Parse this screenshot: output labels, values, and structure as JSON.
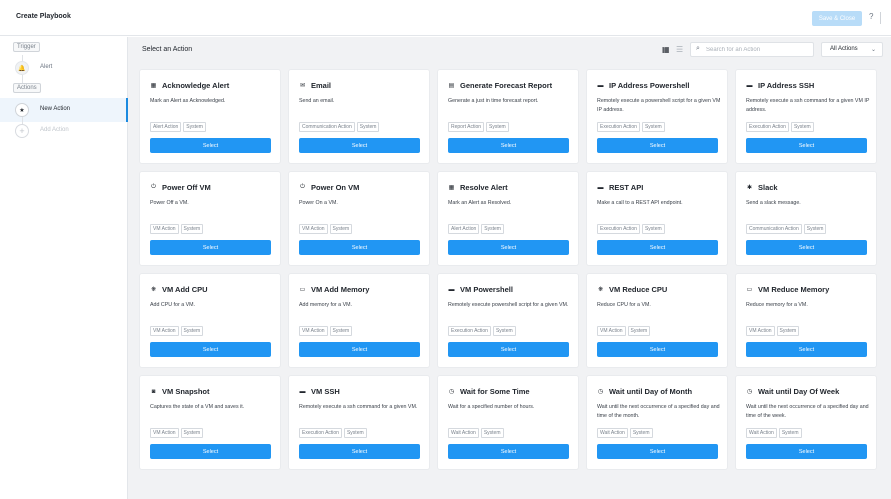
{
  "header": {
    "title": "Create Playbook",
    "save_label": "Save & Close",
    "help_label": "?"
  },
  "sidebar": {
    "trigger_tag": "Trigger",
    "trigger_item": "Alert",
    "actions_tag": "Actions",
    "selected_item": "New Action",
    "add_item": "Add Action"
  },
  "main": {
    "title": "Select an Action",
    "search_placeholder": "Search for an Action",
    "filter_label": "All Actions",
    "select_label": "Select"
  },
  "cards": [
    {
      "title": "Acknowledge Alert",
      "icon": "calendar-check-icon",
      "glyph": "▦",
      "desc": "Mark an Alert as Acknowledged.",
      "tags": [
        "Alert Action",
        "System"
      ]
    },
    {
      "title": "Email",
      "icon": "envelope-icon",
      "glyph": "✉",
      "desc": "Send an email.",
      "tags": [
        "Communication Action",
        "System"
      ]
    },
    {
      "title": "Generate Forecast Report",
      "icon": "report-icon",
      "glyph": "▤",
      "desc": "Generate a just in time forecast report.",
      "tags": [
        "Report Action",
        "System"
      ]
    },
    {
      "title": "IP Address Powershell",
      "icon": "terminal-icon",
      "glyph": "▬",
      "desc": "Remotely execute a powershell script for a given VM IP address.",
      "tags": [
        "Execution Action",
        "System"
      ]
    },
    {
      "title": "IP Address SSH",
      "icon": "terminal-icon",
      "glyph": "▬",
      "desc": "Remotely execute a ssh command for a given VM IP address.",
      "tags": [
        "Execution Action",
        "System"
      ]
    },
    {
      "title": "Power Off VM",
      "icon": "power-icon",
      "glyph": "⏻",
      "desc": "Power Off a VM.",
      "tags": [
        "VM Action",
        "System"
      ]
    },
    {
      "title": "Power On VM",
      "icon": "power-icon",
      "glyph": "⏻",
      "desc": "Power On a VM.",
      "tags": [
        "VM Action",
        "System"
      ]
    },
    {
      "title": "Resolve Alert",
      "icon": "calendar-check-icon",
      "glyph": "▦",
      "desc": "Mark an Alert as Resolved.",
      "tags": [
        "Alert Action",
        "System"
      ]
    },
    {
      "title": "REST API",
      "icon": "api-icon",
      "glyph": "▬",
      "desc": "Make a call to a REST API endpoint.",
      "tags": [
        "Execution Action",
        "System"
      ]
    },
    {
      "title": "Slack",
      "icon": "slack-icon",
      "glyph": "✱",
      "desc": "Send a slack message.",
      "tags": [
        "Communication Action",
        "System"
      ]
    },
    {
      "title": "VM Add CPU",
      "icon": "cpu-icon",
      "glyph": "❋",
      "desc": "Add CPU for a VM.",
      "tags": [
        "VM Action",
        "System"
      ]
    },
    {
      "title": "VM Add Memory",
      "icon": "memory-icon",
      "glyph": "▭",
      "desc": "Add memory for a VM.",
      "tags": [
        "VM Action",
        "System"
      ]
    },
    {
      "title": "VM Powershell",
      "icon": "terminal-icon",
      "glyph": "▬",
      "desc": "Remotely execute powershell script for a given VM.",
      "tags": [
        "Execution Action",
        "System"
      ]
    },
    {
      "title": "VM Reduce CPU",
      "icon": "cpu-icon",
      "glyph": "❋",
      "desc": "Reduce CPU for a VM.",
      "tags": [
        "VM Action",
        "System"
      ]
    },
    {
      "title": "VM Reduce Memory",
      "icon": "memory-icon",
      "glyph": "▭",
      "desc": "Reduce memory for a VM.",
      "tags": [
        "VM Action",
        "System"
      ]
    },
    {
      "title": "VM Snapshot",
      "icon": "camera-icon",
      "glyph": "◙",
      "desc": "Captures the state of a VM and saves it.",
      "tags": [
        "VM Action",
        "System"
      ]
    },
    {
      "title": "VM SSH",
      "icon": "terminal-icon",
      "glyph": "▬",
      "desc": "Remotely execute a ssh command for a given VM.",
      "tags": [
        "Execution Action",
        "System"
      ]
    },
    {
      "title": "Wait for Some Time",
      "icon": "clock-icon",
      "glyph": "◷",
      "desc": "Wait for a specified number of hours.",
      "tags": [
        "Wait Action",
        "System"
      ]
    },
    {
      "title": "Wait until Day of Month",
      "icon": "clock-icon",
      "glyph": "◷",
      "desc": "Wait until the next occurrence of a specified day and time of the month.",
      "tags": [
        "Wait Action",
        "System"
      ]
    },
    {
      "title": "Wait until Day Of Week",
      "icon": "clock-icon",
      "glyph": "◷",
      "desc": "Wait until the next occurrence of a specified day and time of the week.",
      "tags": [
        "Wait Action",
        "System"
      ]
    }
  ],
  "colors": {
    "accent": "#2196f3",
    "save_disabled": "#b8dcf8",
    "background": "#f1f2f4"
  }
}
